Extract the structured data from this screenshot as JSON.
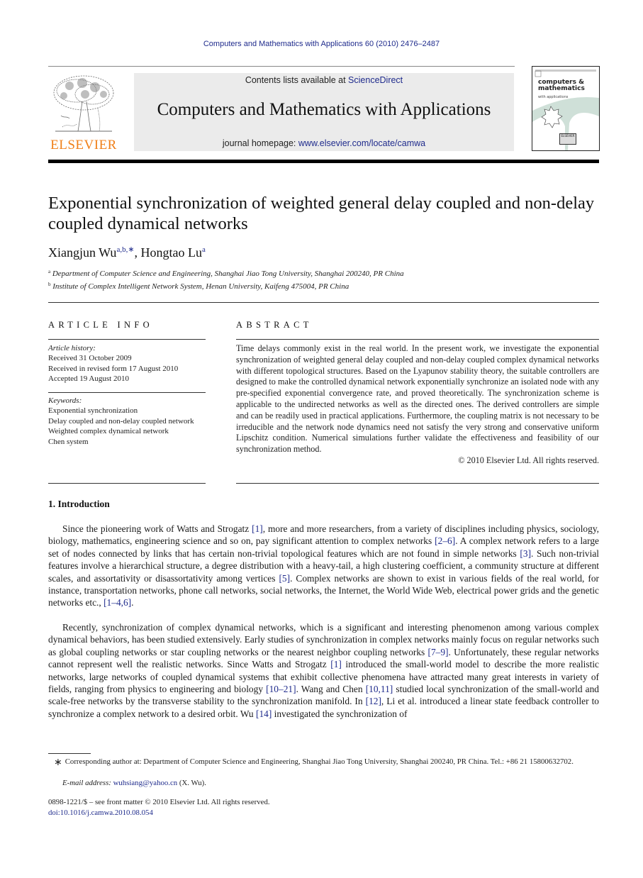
{
  "running_head": "Computers and Mathematics with Applications 60 (2010) 2476–2487",
  "publisher": {
    "wordmark": "ELSEVIER",
    "brand_color": "#f07f18"
  },
  "journal_box": {
    "contents_prefix": "Contents lists available at ",
    "contents_link": "ScienceDirect",
    "journal_title": "Computers and Mathematics with Applications",
    "homepage_prefix": "journal homepage: ",
    "homepage_link": "www.elsevier.com/locate/camwa",
    "link_color": "#1f2b8c"
  },
  "cover": {
    "title_line1": "computers &",
    "title_line2": "mathematics",
    "subtitle": "with applications",
    "badge": "ELSEVIER"
  },
  "article": {
    "title": "Exponential synchronization of weighted general delay coupled and non-delay coupled dynamical networks",
    "authors": [
      {
        "name": "Xiangjun Wu",
        "marks": "a,b,∗"
      },
      {
        "name": "Hongtao Lu",
        "marks": "a"
      }
    ],
    "author_separator": ", ",
    "affiliations": [
      {
        "mark": "a",
        "text": "Department of Computer Science and Engineering, Shanghai Jiao Tong University, Shanghai 200240, PR China"
      },
      {
        "mark": "b",
        "text": "Institute of Complex Intelligent Network System, Henan University, Kaifeng 475004, PR China"
      }
    ]
  },
  "article_info": {
    "heading": "ARTICLE INFO",
    "history_label": "Article history:",
    "history": [
      "Received 31 October 2009",
      "Received in revised form 17 August 2010",
      "Accepted 19 August 2010"
    ],
    "keywords_label": "Keywords:",
    "keywords": [
      "Exponential synchronization",
      "Delay coupled and non-delay coupled network",
      "Weighted complex dynamical network",
      "Chen system"
    ]
  },
  "abstract": {
    "heading": "ABSTRACT",
    "text": "Time delays commonly exist in the real world. In the present work, we investigate the exponential synchronization of weighted general delay coupled and non-delay coupled complex dynamical networks with different topological structures. Based on the Lyapunov stability theory, the suitable controllers are designed to make the controlled dynamical network exponentially synchronize an isolated node with any pre-specified exponential convergence rate, and proved theoretically. The synchronization scheme is applicable to the undirected networks as well as the directed ones. The derived controllers are simple and can be readily used in practical applications. Furthermore, the coupling matrix is not necessary to be irreducible and the network node dynamics need not satisfy the very strong and conservative uniform Lipschitz condition. Numerical simulations further validate the effectiveness and feasibility of our synchronization method.",
    "copyright": "© 2010 Elsevier Ltd. All rights reserved."
  },
  "introduction": {
    "heading": "1.  Introduction",
    "paragraphs": [
      [
        {
          "t": "Since the pioneering work of Watts and Strogatz "
        },
        {
          "ref": "[1]"
        },
        {
          "t": ", more and more researchers, from a variety of disciplines including physics, sociology, biology, mathematics, engineering science and so on, pay significant attention to complex networks "
        },
        {
          "ref": "[2–6]"
        },
        {
          "t": ". A complex network refers to a large set of nodes connected by links that has certain non-trivial topological features which are not found in simple networks "
        },
        {
          "ref": "[3]"
        },
        {
          "t": ". Such non-trivial features involve a hierarchical structure, a degree distribution with a heavy-tail, a high clustering coefficient, a community structure at different scales, and assortativity or disassortativity among vertices "
        },
        {
          "ref": "[5]"
        },
        {
          "t": ". Complex networks are shown to exist in various fields of the real world, for instance, transportation networks, phone call networks, social networks, the Internet, the World Wide Web, electrical power grids and the genetic networks etc., "
        },
        {
          "ref": "[1–4,6]"
        },
        {
          "t": "."
        }
      ],
      [
        {
          "t": "Recently, synchronization of complex dynamical networks, which is a significant and interesting phenomenon among various complex dynamical behaviors, has been studied extensively. Early studies of synchronization in complex networks mainly focus on regular networks such as global coupling networks or star coupling networks or the nearest neighbor coupling networks "
        },
        {
          "ref": "[7–9]"
        },
        {
          "t": ". Unfortunately, these regular networks cannot represent well the realistic networks. Since Watts and Strogatz "
        },
        {
          "ref": "[1]"
        },
        {
          "t": " introduced the small-world model to describe the more realistic networks, large networks of coupled dynamical systems that exhibit collective phenomena have attracted many great interests in variety of fields, ranging from physics to engineering and biology "
        },
        {
          "ref": "[10–21]"
        },
        {
          "t": ". Wang and Chen "
        },
        {
          "ref": "[10,11]"
        },
        {
          "t": " studied local synchronization of the small-world and scale-free networks by the transverse stability to the synchronization manifold. In "
        },
        {
          "ref": "[12]"
        },
        {
          "t": ", Li et al. introduced a linear state feedback controller to synchronize a complex network to a desired orbit. Wu "
        },
        {
          "ref": "[14]"
        },
        {
          "t": " investigated the synchronization of"
        }
      ]
    ]
  },
  "footnotes": {
    "star": "∗",
    "corresponding": "Corresponding author at: Department of Computer Science and Engineering, Shanghai Jiao Tong University, Shanghai 200240, PR China. Tel.: +86 21 15800632702.",
    "email_label": "E-mail address: ",
    "email": "wuhsiang@yahoo.cn",
    "email_suffix": " (X. Wu).",
    "front_matter": "0898-1221/$ – see front matter © 2010 Elsevier Ltd. All rights reserved.",
    "doi": "doi:10.1016/j.camwa.2010.08.054"
  }
}
